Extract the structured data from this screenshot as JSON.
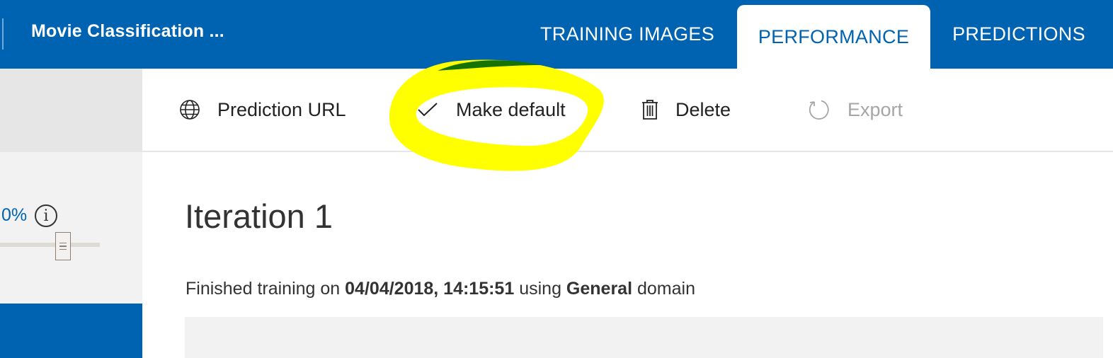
{
  "header": {
    "project_title": "Movie Classification ...",
    "tabs": [
      {
        "label": "TRAINING IMAGES",
        "active": false
      },
      {
        "label": "PERFORMANCE",
        "active": true
      },
      {
        "label": "PREDICTIONS",
        "active": false
      }
    ]
  },
  "sidebar": {
    "threshold_value": "0%",
    "info_icon_glyph": "i",
    "slider_value_fraction": 0.63
  },
  "toolbar": {
    "prediction_url_label": "Prediction URL",
    "make_default_label": "Make default",
    "delete_label": "Delete",
    "export_label": "Export",
    "icons": {
      "prediction_url": "globe-icon",
      "make_default": "checkmark-icon",
      "delete": "trash-icon",
      "export": "refresh-icon"
    }
  },
  "main": {
    "iteration_title": "Iteration 1",
    "training_info": {
      "prefix": "Finished training on",
      "date": "04/04/2018, 14:15:51",
      "middle": "using",
      "domain": "General",
      "suffix": "domain"
    }
  },
  "colors": {
    "brand_blue": "#0063b1",
    "highlight_yellow": "#ffff00",
    "disabled_gray": "#a6a6a6"
  }
}
